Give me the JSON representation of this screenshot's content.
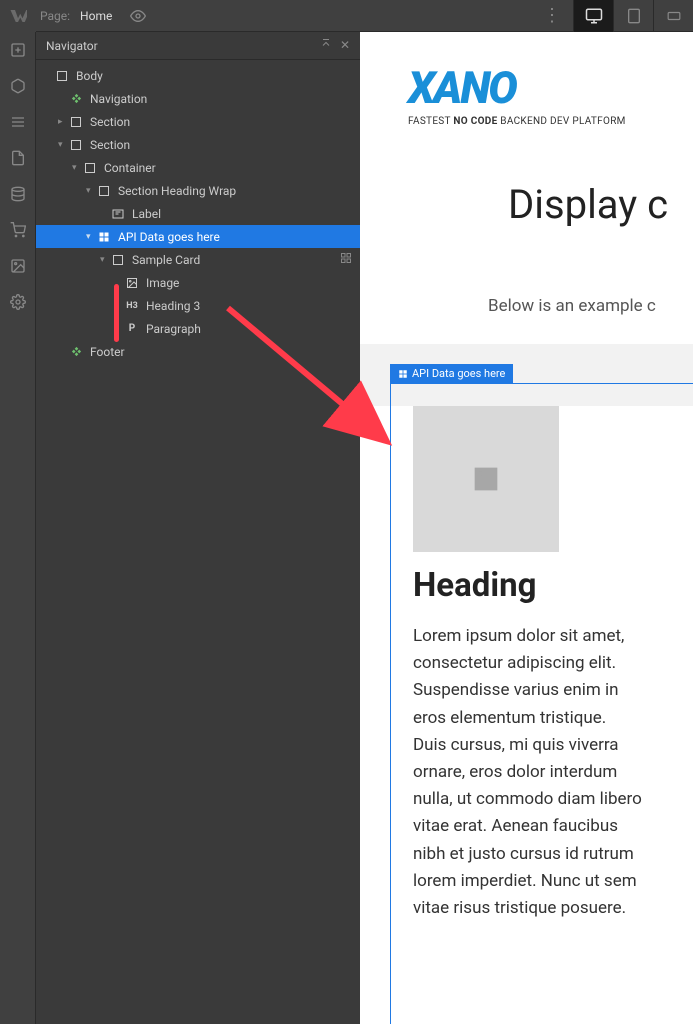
{
  "topbar": {
    "page_label": "Page:",
    "page_name": "Home"
  },
  "navigator": {
    "title": "Navigator",
    "nodes": {
      "body": "Body",
      "navigation": "Navigation",
      "section1": "Section",
      "section2": "Section",
      "container": "Container",
      "sectionHeadingWrap": "Section Heading Wrap",
      "label": "Label",
      "apiData": "API Data goes here",
      "sampleCard": "Sample Card",
      "image": "Image",
      "heading3": "Heading 3",
      "paragraph": "Paragraph",
      "footer": "Footer"
    }
  },
  "canvas": {
    "logo_text": "XANO",
    "tagline_pre": "FASTEST ",
    "tagline_bold": "NO CODE",
    "tagline_post": " BACKEND DEV PLATFORM",
    "title": "Display c",
    "subtitle": "Below is an example c",
    "api_label": "API Data goes here",
    "card_heading": "Heading",
    "card_text": "Lorem ipsum dolor sit amet, consectetur adipiscing elit. Suspendisse varius enim in eros elementum tristique. Duis cursus, mi quis viverra ornare, eros dolor interdum nulla, ut commodo diam libero vitae erat. Aenean faucibus nibh et justo cursus id rutrum lorem imperdiet. Nunc ut sem vitae risus tristique posuere."
  }
}
